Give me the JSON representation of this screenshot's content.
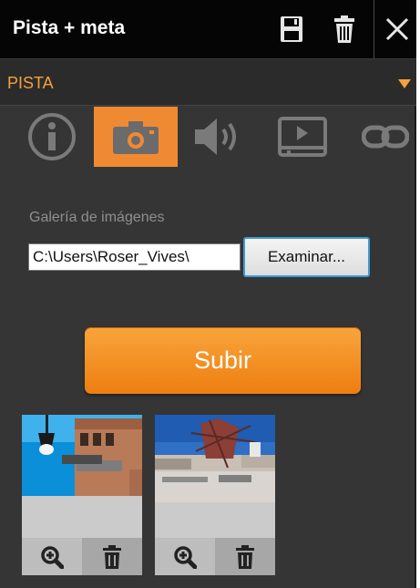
{
  "header": {
    "title": "Pista + meta",
    "icons": [
      "save-icon",
      "trash-icon",
      "close-icon"
    ]
  },
  "section": {
    "label": "PISTA",
    "toggle_icon": "triangle-down-icon"
  },
  "tabs": [
    {
      "id": "info",
      "icon": "info-icon",
      "active": false
    },
    {
      "id": "images",
      "icon": "camera-icon",
      "active": true
    },
    {
      "id": "audio",
      "icon": "speaker-icon",
      "active": false
    },
    {
      "id": "video",
      "icon": "video-player-icon",
      "active": false
    },
    {
      "id": "link",
      "icon": "link-icon",
      "active": false
    }
  ],
  "gallery": {
    "label": "Galería de imágenes",
    "path_value": "C:\\Users\\Roser_Vives\\",
    "browse_label": "Examinar...",
    "upload_label": "Subir",
    "thumbnails": [
      {
        "actions": [
          "zoom-in-icon",
          "trash-icon"
        ]
      },
      {
        "actions": [
          "zoom-in-icon",
          "trash-icon"
        ]
      }
    ]
  },
  "colors": {
    "accent": "#f08a32",
    "section_text": "#f4a23a",
    "panel_bg": "#353535",
    "titlebar_bg": "#050505"
  }
}
